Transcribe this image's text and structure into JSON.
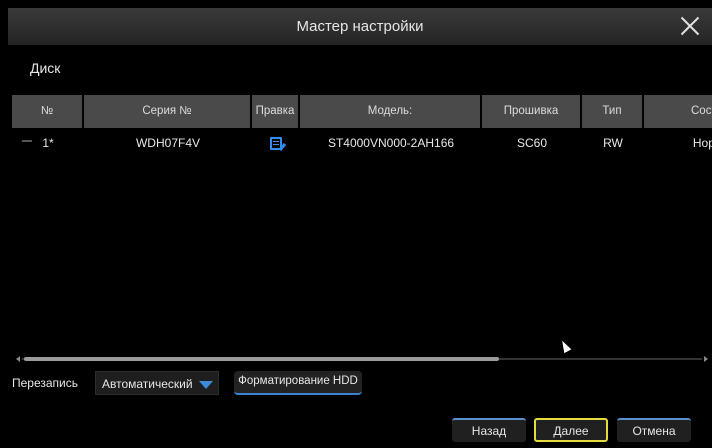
{
  "dialog": {
    "title": "Мастер настройки"
  },
  "section": {
    "label": "Диск"
  },
  "table": {
    "headers": [
      "№",
      "Серия №",
      "Правка",
      "Модель:",
      "Прошивка",
      "Тип",
      "Состо"
    ],
    "rows": [
      {
        "no": "1*",
        "serial": "WDH07F4V",
        "model": "ST4000VN000-2AH166",
        "firmware": "SC60",
        "type": "RW",
        "status": "Норм"
      }
    ]
  },
  "overwrite": {
    "label": "Перезапись",
    "value": "Автоматический"
  },
  "buttons": {
    "format": "Форматирование HDD",
    "back": "Назад",
    "next": "Далее",
    "cancel": "Отмена"
  },
  "colors": {
    "accent": "#3b82d0",
    "focus": "#e3dc3c"
  }
}
